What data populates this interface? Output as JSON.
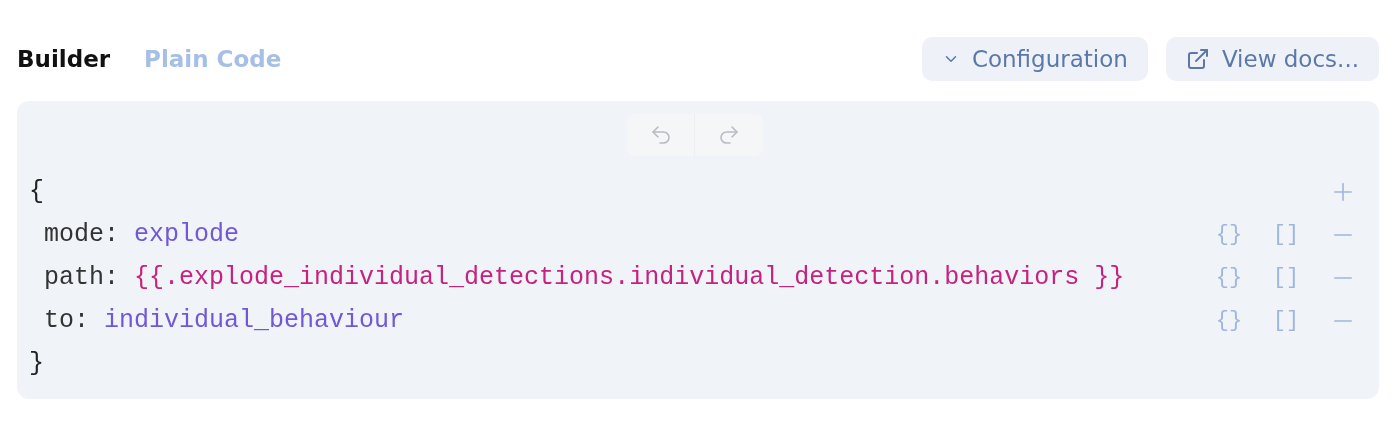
{
  "tabs": [
    {
      "label": "Builder",
      "selected": true
    },
    {
      "label": "Plain Code",
      "selected": false
    }
  ],
  "actions": [
    {
      "kind": "dropdown",
      "label": "Configuration"
    },
    {
      "kind": "external",
      "label": "View docs..."
    }
  ],
  "editor": {
    "open_brace": "{",
    "close_brace": "}",
    "fields": [
      {
        "key": "mode:",
        "value": "explode",
        "kind": "literal",
        "object_button": "{}",
        "array_button": "[]"
      },
      {
        "key": "path:",
        "value": "{{.explode_individual_detections.individual_detection.behaviors }}",
        "kind": "template",
        "object_button": "{}",
        "array_button": "[]"
      },
      {
        "key": "to:",
        "value": "individual_behaviour",
        "kind": "literal",
        "object_button": "{}",
        "array_button": "[]"
      }
    ]
  }
}
